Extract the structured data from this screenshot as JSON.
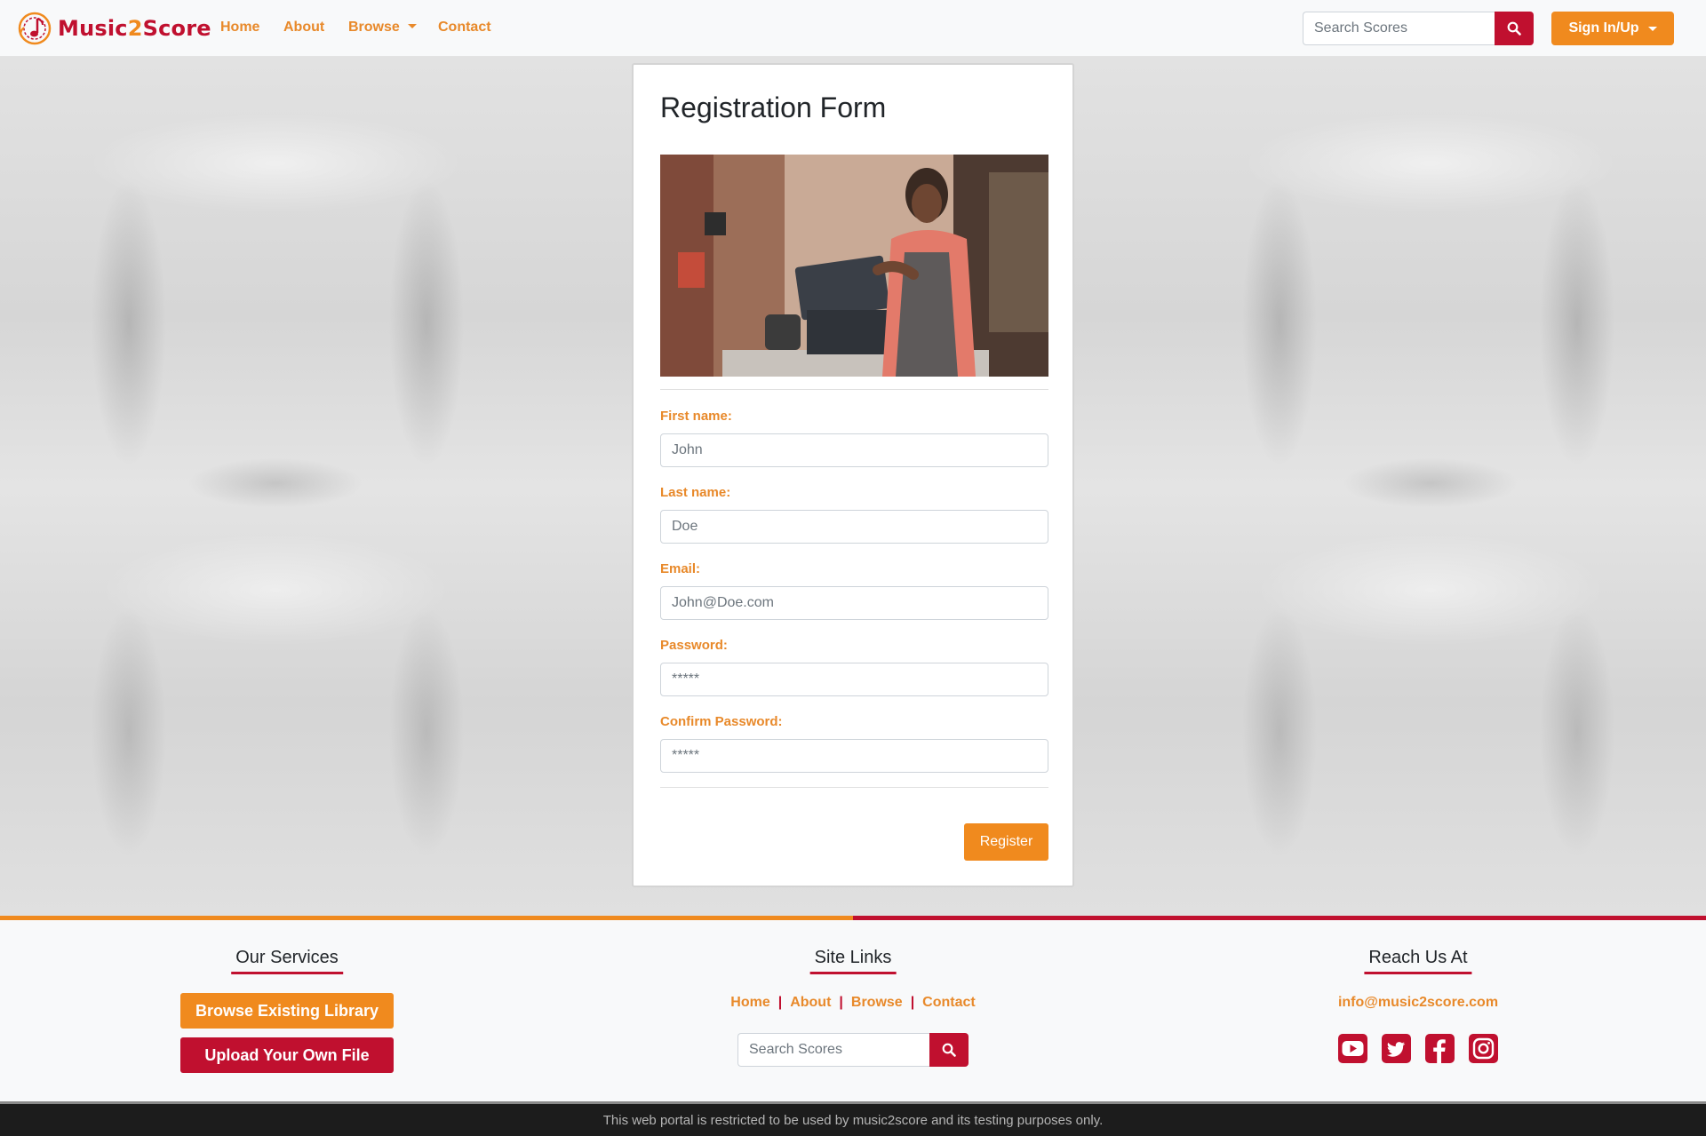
{
  "brand": {
    "name_part1": "Music",
    "name_part2": "2",
    "name_part3": "Score",
    "logo_icon": "music-note-logo-icon",
    "primary_color": "#c0102f",
    "accent_color": "#f08a1e"
  },
  "nav": {
    "home": "Home",
    "about": "About",
    "browse": "Browse",
    "contact": "Contact",
    "search_placeholder": "Search Scores",
    "search_icon": "search-icon",
    "signin_label": "Sign In/Up"
  },
  "form": {
    "title": "Registration Form",
    "image_icon": "cashier-photo",
    "fields": [
      {
        "label": "First name:",
        "placeholder": "John"
      },
      {
        "label": "Last name:",
        "placeholder": "Doe"
      },
      {
        "label": "Email:",
        "placeholder": "John@Doe.com"
      },
      {
        "label": "Password:",
        "placeholder": "*****"
      },
      {
        "label": "Confirm Password:",
        "placeholder": "*****"
      }
    ],
    "register_label": "Register"
  },
  "footer": {
    "services_heading": "Our Services",
    "browse_library": "Browse Existing Library",
    "upload_file": "Upload Your Own File",
    "sitelinks_heading": "Site Links",
    "links": [
      "Home",
      "About",
      "Browse",
      "Contact"
    ],
    "separator": "|",
    "search_placeholder": "Search Scores",
    "reach_heading": "Reach Us At",
    "email": "info@music2score.com",
    "social_icons": [
      "youtube-icon",
      "twitter-icon",
      "facebook-icon",
      "instagram-icon"
    ]
  },
  "disclaimer": "This web portal is restricted to be used by music2score and its testing purposes only."
}
